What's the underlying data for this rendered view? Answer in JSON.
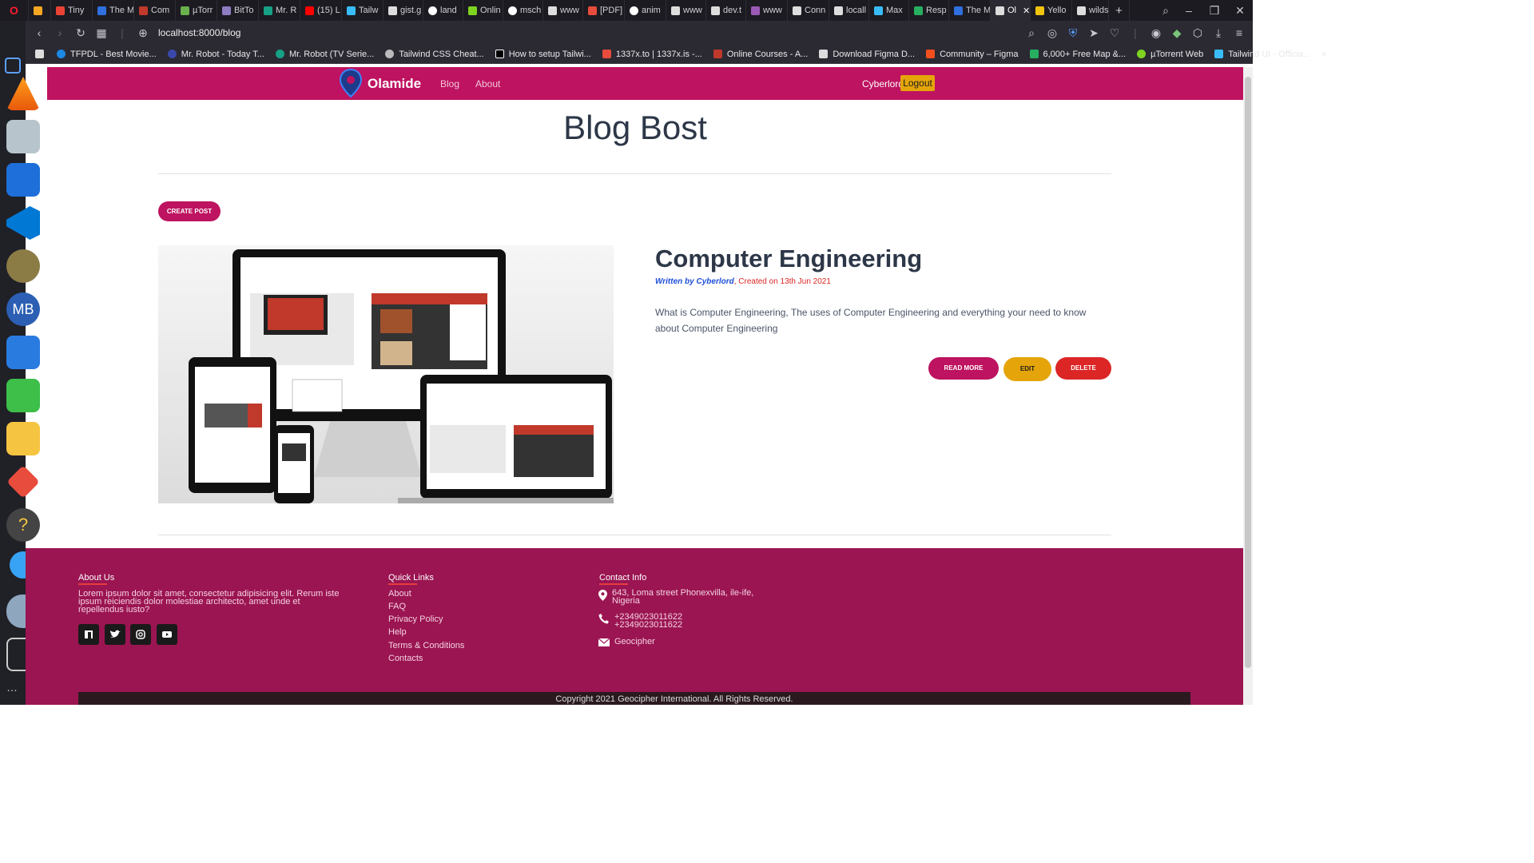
{
  "browser": {
    "tabs": [
      "Tiny",
      "The M",
      "Com",
      "µTorr",
      "BitTo",
      "Mr. R",
      "(15) L",
      "Tailw",
      "gist.g",
      "land",
      "Onlin",
      "msch",
      "www",
      "[PDF]",
      "anim",
      "www",
      "dev.t",
      "www",
      "Conn",
      "locall",
      "Max",
      "Resp",
      "The M",
      "Ol",
      "Yello",
      "wilds"
    ],
    "active_tab_index": 23,
    "url": "localhost:8000/blog",
    "bookmarks": [
      "TFPDL - Best Movie...",
      "Mr. Robot - Today T...",
      "Mr. Robot (TV Serie...",
      "Tailwind CSS Cheat...",
      "How to setup Tailwi...",
      "1337x.to | 1337x.is -...",
      "Online Courses - A...",
      "Download Figma D...",
      "Community – Figma",
      "6,000+ Free Map &...",
      "µTorrent Web",
      "Tailwind UI - Officia..."
    ]
  },
  "header": {
    "logo": "Olamide",
    "nav": [
      "Blog",
      "About"
    ],
    "user": "Cyberlord",
    "logout": "Logout"
  },
  "main": {
    "title": "Blog Bost",
    "create_post": "CREATE POST",
    "post": {
      "title": "Computer Engineering",
      "author": "Written by Cyberlord",
      "date": ", Created on 13th Jun 2021",
      "excerpt": "What is Computer Engineering, The uses of Computer Engineering and everything your need to know about Computer Engineering",
      "read_more": "READ MORE",
      "edit": "EDIT",
      "delete": "DELETE"
    }
  },
  "footer": {
    "about_title": "About Us",
    "about_text": "Lorem ipsum dolor sit amet, consectetur adipisicing elit. Rerum iste ipsum reiciendis dolor molestiae architecto, amet unde et repellendus iusto?",
    "links_title": "Quick Links",
    "links": [
      "About",
      "FAQ",
      "Privacy Policy",
      "Help",
      "Terms & Conditions",
      "Contacts"
    ],
    "contact_title": "Contact Info",
    "address": "643, Loma street Phonexvilla, ile-ife, Nigeria",
    "phone1": "+2349023011622",
    "phone2": "+2349023011622",
    "email": "Geocipher",
    "copyright": "Copyright 2021 Geocipher International. All Rights Reserved."
  },
  "colors": {
    "brand": "#be1360",
    "footer": "#9b1552",
    "edit": "#e5a50a",
    "delete": "#dc2626"
  }
}
